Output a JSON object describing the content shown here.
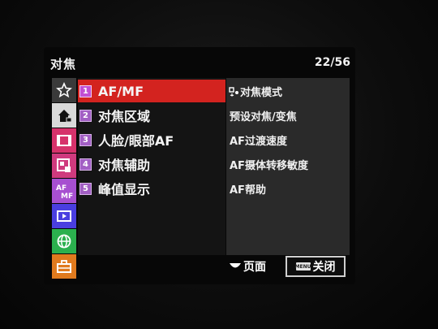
{
  "header": {
    "title": "对焦",
    "page": "22/56"
  },
  "tabs": [
    {
      "icon": "star-icon",
      "color": "#3a3a3a"
    },
    {
      "icon": "camera-home-icon",
      "color": "#d9d9d9",
      "selected": true
    },
    {
      "icon": "movie-icon",
      "color": "#d6326b"
    },
    {
      "icon": "photo-edit-icon",
      "color": "#cf3a7e"
    },
    {
      "icon": "af-mf-icon",
      "color": "#a74fd0"
    },
    {
      "icon": "playback-icon",
      "color": "#4a3ee0"
    },
    {
      "icon": "globe-icon",
      "color": "#2bb04e"
    },
    {
      "icon": "toolbox-icon",
      "color": "#e07a1e"
    }
  ],
  "menu": {
    "items": [
      {
        "num": "1",
        "label": "AF/MF",
        "selected": true
      },
      {
        "num": "2",
        "label": "对焦区域"
      },
      {
        "num": "3",
        "label": "人脸/眼部AF"
      },
      {
        "num": "4",
        "label": "对焦辅助"
      },
      {
        "num": "5",
        "label": "峰值显示"
      }
    ]
  },
  "submenu": {
    "items": [
      "对焦模式",
      "预设对焦/变焦",
      "AF过渡速度",
      "AF摄体转移敏度",
      "AF帮助"
    ]
  },
  "footer": {
    "page_label": "页面",
    "close_label": "关闭"
  }
}
